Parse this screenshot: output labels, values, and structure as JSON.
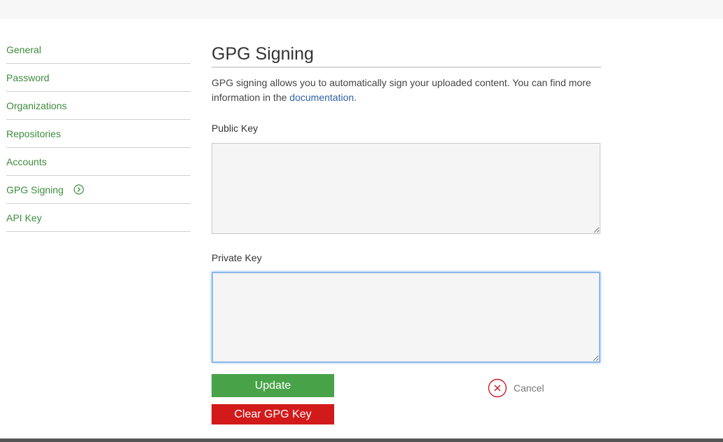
{
  "sidebar": {
    "items": [
      {
        "label": "General"
      },
      {
        "label": "Password"
      },
      {
        "label": "Organizations"
      },
      {
        "label": "Repositories"
      },
      {
        "label": "Accounts"
      },
      {
        "label": "GPG Signing",
        "active": true
      },
      {
        "label": "API Key"
      }
    ]
  },
  "main": {
    "title": "GPG Signing",
    "description_text": "GPG signing allows you to automatically sign your uploaded content. You can find more information in the ",
    "description_link": "documentation",
    "description_end": ".",
    "public_key_label": "Public Key",
    "public_key_value": "",
    "private_key_label": "Private Key",
    "private_key_value": ""
  },
  "actions": {
    "update_label": "Update",
    "clear_label": "Clear GPG Key",
    "cancel_label": "Cancel"
  },
  "colors": {
    "link_green": "#3d8c3d",
    "update_green": "#48a348",
    "clear_red": "#d21a1a",
    "doc_link_blue": "#2f62a8",
    "focus_blue": "#8ab8ea"
  },
  "icons": {
    "active_marker": "chevron-right-circle-icon",
    "cancel": "close-circle-icon"
  }
}
